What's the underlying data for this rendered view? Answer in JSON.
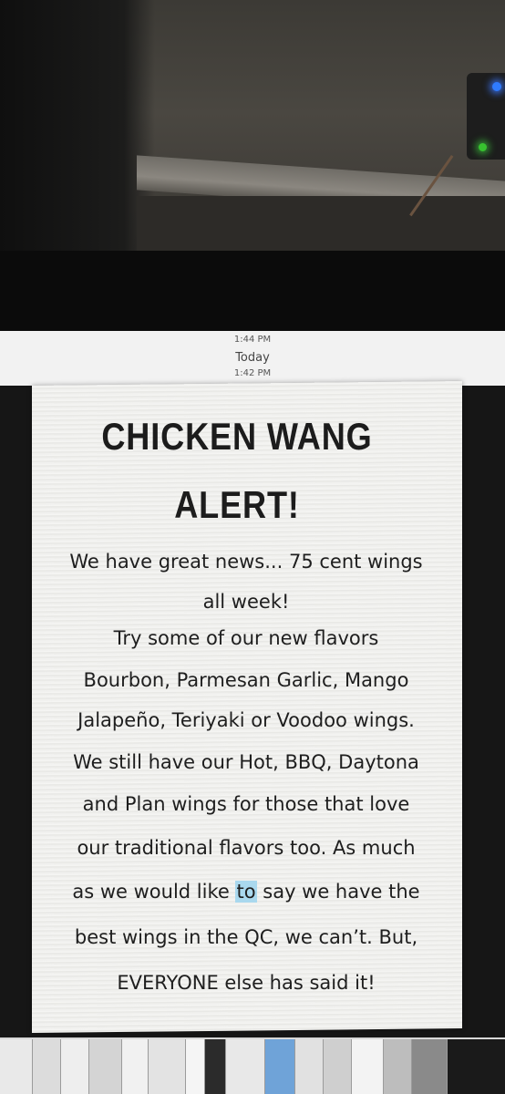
{
  "chat_header": {
    "time_top": "1:44 PM",
    "day_label": "Today",
    "time_bottom": "1:42 PM"
  },
  "flyer": {
    "title_line1": "CHICKEN WANG",
    "title_line2": "ALERT!",
    "lines": [
      "We have great news... 75 cent wings",
      "all week!",
      "Try some of our new flavors",
      "Bourbon, Parmesan Garlic, Mango",
      "Jalapeño, Teriyaki or Voodoo wings.",
      "We still have our Hot, BBQ, Daytona",
      "and Plan wings for those that love",
      "our traditional flavors too. As much"
    ],
    "line9_before": "as we would like ",
    "line9_highlight": "to",
    "line9_after": " say we have the",
    "line10": "best wings in the QC, we can’t. But,",
    "line11": "EVERYONE else has said it!"
  },
  "colors": {
    "highlight": "#a9d8ee",
    "led_blue": "#2f7bff",
    "led_green": "#37c22f"
  }
}
